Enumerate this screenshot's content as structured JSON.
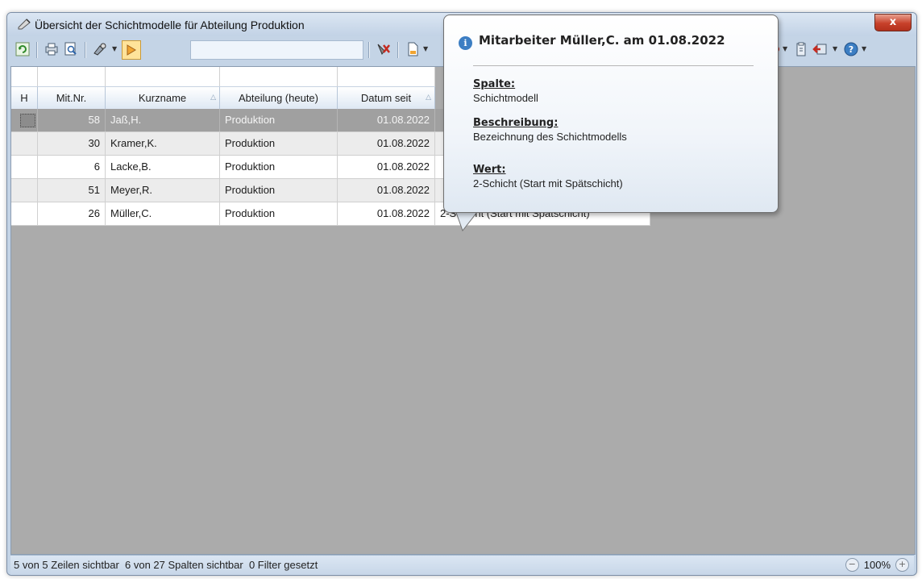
{
  "window": {
    "title": "Übersicht der Schichtmodelle für Abteilung Produktion",
    "close_label": "x"
  },
  "toolbar": {
    "search_value": ""
  },
  "grid": {
    "columns": [
      {
        "label": "H"
      },
      {
        "label": "Mit.Nr."
      },
      {
        "label": "Kurzname"
      },
      {
        "label": "Abteilung (heute)"
      },
      {
        "label": "Datum seit"
      }
    ],
    "rows": [
      {
        "nr": "58",
        "name": "Jaß,H.",
        "abteilung": "Produktion",
        "datum": "01.08.2022",
        "modell": ""
      },
      {
        "nr": "30",
        "name": "Kramer,K.",
        "abteilung": "Produktion",
        "datum": "01.08.2022",
        "modell": ""
      },
      {
        "nr": "6",
        "name": "Lacke,B.",
        "abteilung": "Produktion",
        "datum": "01.08.2022",
        "modell": ""
      },
      {
        "nr": "51",
        "name": "Meyer,R.",
        "abteilung": "Produktion",
        "datum": "01.08.2022",
        "modell": ""
      },
      {
        "nr": "26",
        "name": "Müller,C.",
        "abteilung": "Produktion",
        "datum": "01.08.2022",
        "modell": "2-Schicht (Start mit Spätschicht)"
      }
    ]
  },
  "tooltip": {
    "title": "Mitarbeiter Müller,C. am 01.08.2022",
    "spalte_label": "Spalte:",
    "spalte_value": "Schichtmodell",
    "beschreibung_label": "Beschreibung:",
    "beschreibung_value": "Bezeichnung des Schichtmodells",
    "wert_label": "Wert:",
    "wert_value": "2-Schicht (Start mit Spätschicht)"
  },
  "status": {
    "text": "5 von 5 Zeilen sichtbar  6 von 27 Spalten sichtbar  0 Filter gesetzt",
    "zoom": "100%"
  },
  "colors": {
    "selected_row": "#a0a0a0",
    "alt_row": "#ececec",
    "window_frame": "#c4d4e6",
    "close_button": "#c7412a"
  }
}
